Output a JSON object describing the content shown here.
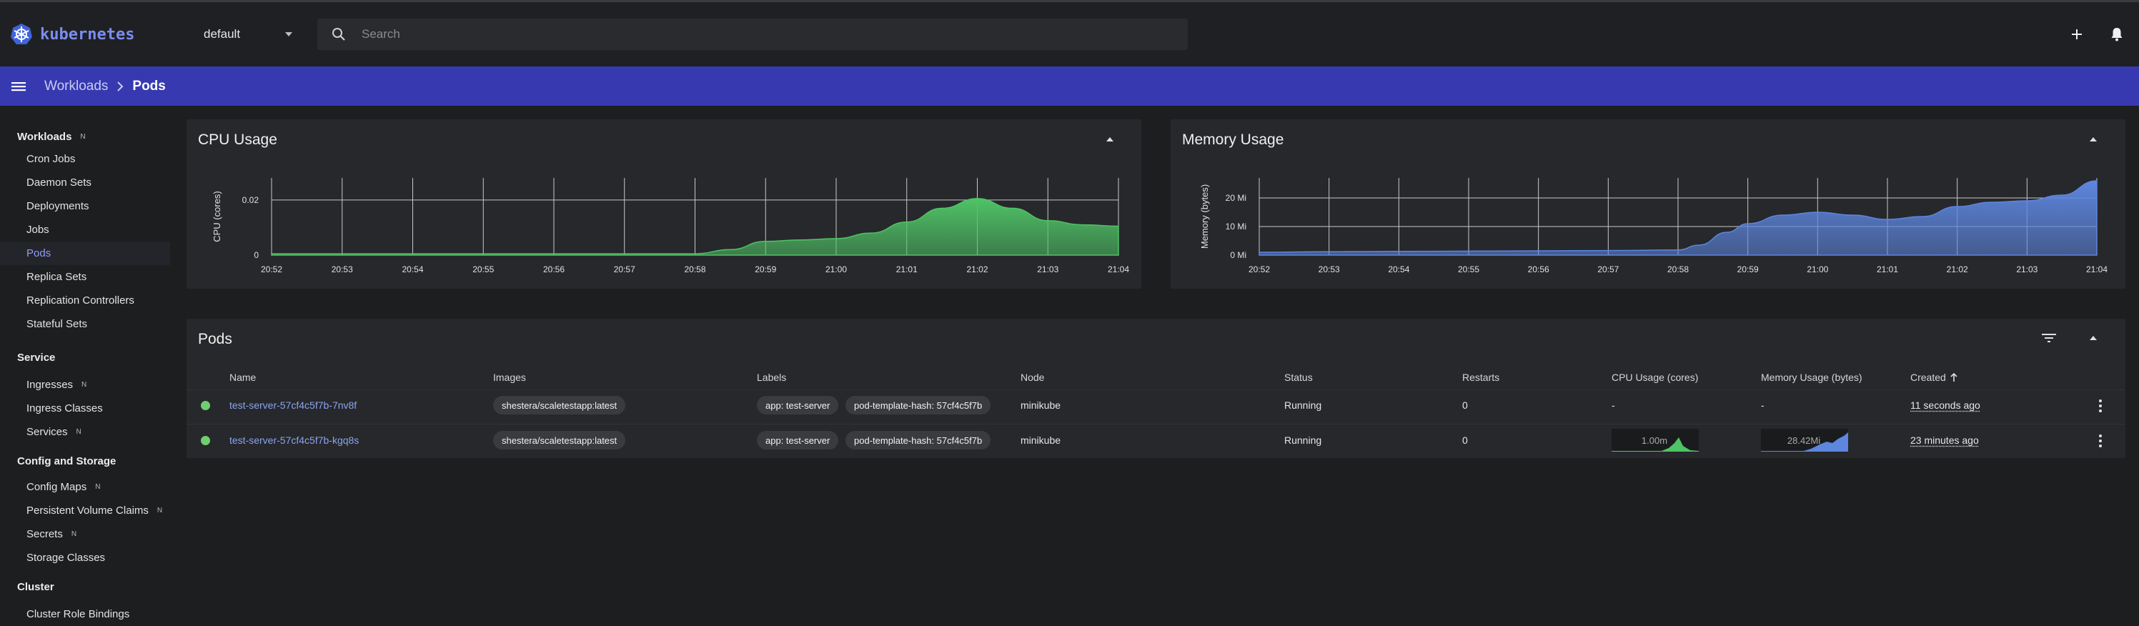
{
  "app": {
    "logo_text": "kubernetes",
    "namespace": "default"
  },
  "search": {
    "placeholder": "Search"
  },
  "breadcrumb": {
    "parent": "Workloads",
    "current": "Pods"
  },
  "sidebar": {
    "sections": [
      {
        "title": "Workloads",
        "badge": "N"
      },
      {
        "title": "Service"
      },
      {
        "title": "Config and Storage"
      },
      {
        "title": "Cluster"
      }
    ],
    "items": [
      {
        "label": "Cron Jobs"
      },
      {
        "label": "Daemon Sets"
      },
      {
        "label": "Deployments"
      },
      {
        "label": "Jobs"
      },
      {
        "label": "Pods",
        "active": true
      },
      {
        "label": "Replica Sets"
      },
      {
        "label": "Replication Controllers"
      },
      {
        "label": "Stateful Sets"
      },
      {
        "label": "Ingresses",
        "badge": "N"
      },
      {
        "label": "Ingress Classes"
      },
      {
        "label": "Services",
        "badge": "N"
      },
      {
        "label": "Config Maps",
        "badge": "N"
      },
      {
        "label": "Persistent Volume Claims",
        "badge": "N"
      },
      {
        "label": "Secrets",
        "badge": "N"
      },
      {
        "label": "Storage Classes"
      },
      {
        "label": "Cluster Role Bindings"
      }
    ]
  },
  "cpu_card": {
    "title": "CPU Usage"
  },
  "memory_card": {
    "title": "Memory Usage"
  },
  "chart_data": [
    {
      "type": "area",
      "title": "CPU Usage",
      "ylabel": "CPU (cores)",
      "xlabel": "",
      "x_ticks": [
        "20:52",
        "20:53",
        "20:54",
        "20:55",
        "20:56",
        "20:57",
        "20:58",
        "20:59",
        "21:00",
        "21:01",
        "21:02",
        "21:03",
        "21:04"
      ],
      "y_ticks": [
        "0",
        "0.02"
      ],
      "ylim": [
        0,
        0.028
      ],
      "grid": true,
      "color": "#4fc366",
      "x": [
        0,
        1,
        2,
        3,
        4,
        5,
        6,
        6.5,
        7,
        7.5,
        8,
        8.5,
        9,
        9.5,
        10,
        10.5,
        11,
        11.5,
        12
      ],
      "values": [
        0.0005,
        0.0005,
        0.0005,
        0.0005,
        0.0005,
        0.0005,
        0.0005,
        0.002,
        0.005,
        0.0055,
        0.006,
        0.008,
        0.012,
        0.017,
        0.0205,
        0.017,
        0.0125,
        0.011,
        0.0105
      ]
    },
    {
      "type": "area",
      "title": "Memory Usage",
      "ylabel": "Memory (bytes)",
      "xlabel": "",
      "x_ticks": [
        "20:52",
        "20:53",
        "20:54",
        "20:55",
        "20:56",
        "20:57",
        "20:58",
        "20:59",
        "21:00",
        "21:01",
        "21:02",
        "21:03",
        "21:04"
      ],
      "y_ticks": [
        "0 Mi",
        "10 Mi",
        "20 Mi"
      ],
      "ylim": [
        0,
        27
      ],
      "grid": true,
      "color": "#5d86df",
      "x": [
        0,
        1,
        2,
        3,
        4,
        5,
        6,
        6.3,
        6.7,
        7,
        7.5,
        8,
        8.5,
        9,
        9.5,
        10,
        10.5,
        11,
        11.5,
        12
      ],
      "values": [
        1,
        1.2,
        1.3,
        1.4,
        1.5,
        1.6,
        1.8,
        3.5,
        8,
        11,
        14,
        15,
        14,
        12.5,
        13.5,
        17,
        18.5,
        19,
        21,
        26
      ]
    }
  ],
  "pods": {
    "title": "Pods",
    "columns": [
      "Name",
      "Images",
      "Labels",
      "Node",
      "Status",
      "Restarts",
      "CPU Usage (cores)",
      "Memory Usage (bytes)",
      "Created"
    ],
    "rows": [
      {
        "name": "test-server-57cf4c5f7b-7nv8f",
        "image": "shestera/scaletestapp:latest",
        "labels": [
          "app: test-server",
          "pod-template-hash: 57cf4c5f7b"
        ],
        "node": "minikube",
        "status": "Running",
        "restarts": "0",
        "cpu": "-",
        "memory": "-",
        "created": "11 seconds ago"
      },
      {
        "name": "test-server-57cf4c5f7b-kgq8s",
        "image": "shestera/scaletestapp:latest",
        "labels": [
          "app: test-server",
          "pod-template-hash: 57cf4c5f7b"
        ],
        "node": "minikube",
        "status": "Running",
        "restarts": "0",
        "cpu_spark_label": "1.00m",
        "memory_spark_label": "28.42Mi",
        "created": "23 minutes ago"
      }
    ]
  },
  "colors": {
    "accent": "#3639b0",
    "running": "#6fcf6f",
    "cpu": "#4fc366",
    "memory": "#5d86df",
    "link": "#8aa4f0"
  }
}
